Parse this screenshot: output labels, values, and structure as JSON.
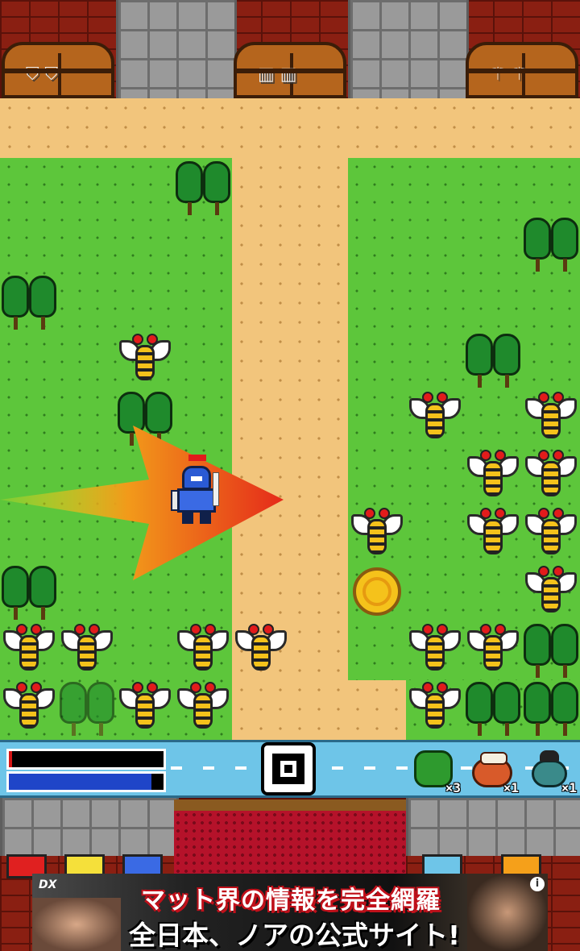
{
  "top_wall": {
    "chests": [
      {
        "item_icon": "shield-icon",
        "glyph": "⛉ ⛉"
      },
      {
        "item_icon": "armor-icon",
        "glyph": "▥ ▥"
      },
      {
        "item_icon": "weapon-icon",
        "glyph": "⚚ ⚚"
      }
    ]
  },
  "player": {
    "name": "knight-player",
    "hp_fraction": 0.02,
    "mp_fraction": 0.92,
    "facing": "right"
  },
  "hud": {
    "hp_bar_color": "#d41414",
    "mp_bar_color": "#1f45c8",
    "center_button_glyph": "■",
    "items": [
      {
        "name": "herb-item",
        "count": "×3"
      },
      {
        "name": "meat-item",
        "count": "×1"
      },
      {
        "name": "beetle-item",
        "count": "×1"
      }
    ]
  },
  "ad": {
    "brand": "DX",
    "line1": "マット界の情報を完全網羅",
    "line2": "全日本、ノアの公式サイト!",
    "info_glyph": "i"
  },
  "colors": {
    "grass": "#5dc63b",
    "sand": "#f2c57c",
    "brick": "#8a1f12",
    "attack_arrow": "#e52a1a"
  }
}
